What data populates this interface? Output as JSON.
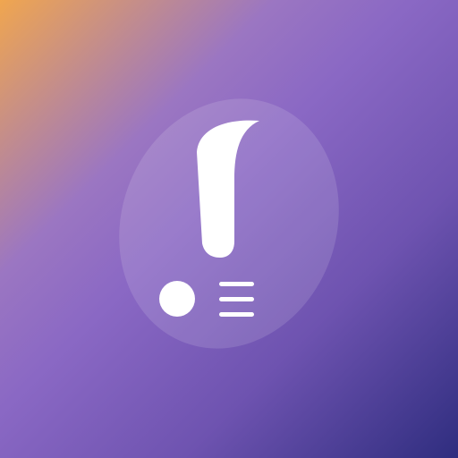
{
  "app_icon": {
    "icon_name": "exclamation-notes-icon",
    "colors": {
      "gradient_start": "#f0a64f",
      "gradient_mid": "#8a68c4",
      "gradient_end": "#2f2d7f",
      "glyph": "#ffffff"
    }
  }
}
